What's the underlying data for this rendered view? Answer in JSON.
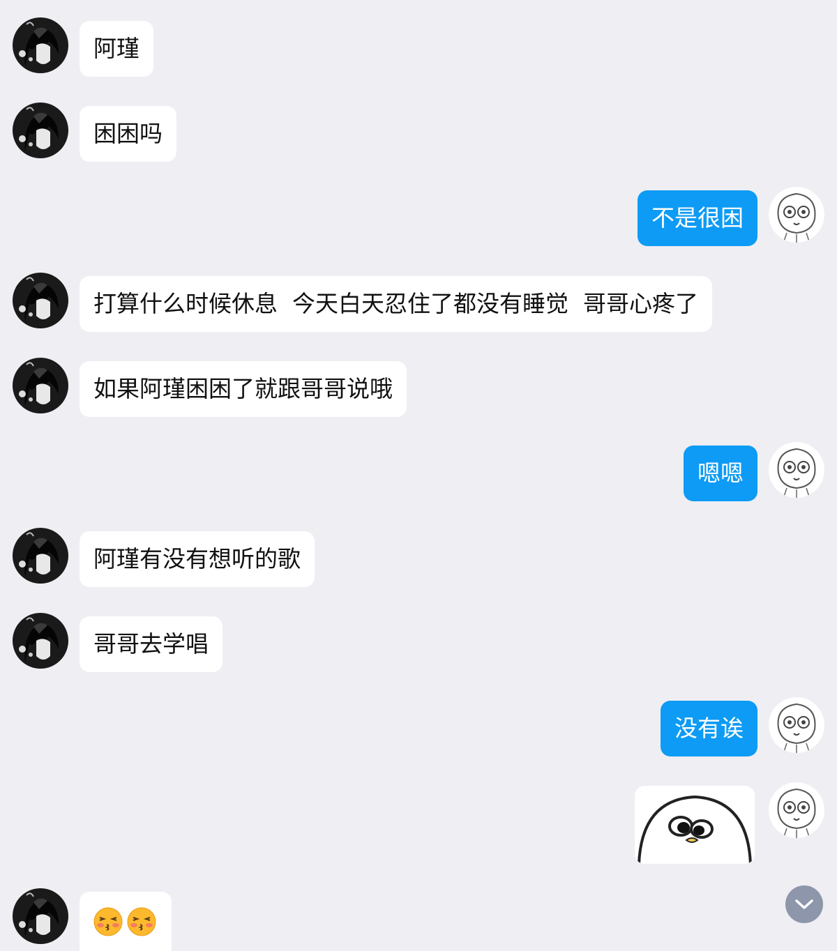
{
  "messages": [
    {
      "side": "left",
      "text": "阿瑾"
    },
    {
      "side": "left",
      "text": "困困吗"
    },
    {
      "side": "right",
      "text": "不是很困"
    },
    {
      "side": "left",
      "text": "打算什么时候休息  今天白天忍住了都没有睡觉  哥哥心疼了"
    },
    {
      "side": "left",
      "text": "如果阿瑾困困了就跟哥哥说哦"
    },
    {
      "side": "right",
      "text": "嗯嗯"
    },
    {
      "side": "left",
      "text": "阿瑾有没有想听的歌"
    },
    {
      "side": "left",
      "text": "哥哥去学唱"
    },
    {
      "side": "right",
      "text": "没有诶"
    },
    {
      "side": "right",
      "type": "sticker",
      "sticker": "white-blob-eyes-sticker"
    },
    {
      "side": "left",
      "type": "emoji",
      "emojis": [
        "kissing-blushing-emoji",
        "kissing-blushing-emoji"
      ]
    }
  ],
  "icons": {
    "scroll_down": "chevron-down-icon",
    "left_avatar": "dark-anime-avatar",
    "right_avatar": "sketch-face-avatar"
  },
  "colors": {
    "background": "#eeeef3",
    "incoming_bubble": "#ffffff",
    "outgoing_bubble": "#0d9bf5",
    "scroll_button": "#8e96ab"
  }
}
